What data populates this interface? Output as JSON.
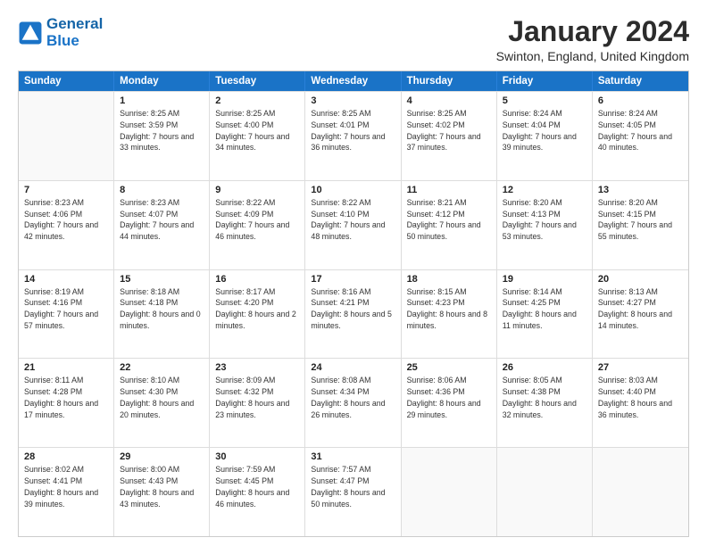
{
  "header": {
    "logo_line1": "General",
    "logo_line2": "Blue",
    "month": "January 2024",
    "location": "Swinton, England, United Kingdom"
  },
  "weekdays": [
    "Sunday",
    "Monday",
    "Tuesday",
    "Wednesday",
    "Thursday",
    "Friday",
    "Saturday"
  ],
  "rows": [
    [
      {
        "day": "",
        "sunrise": "",
        "sunset": "",
        "daylight": ""
      },
      {
        "day": "1",
        "sunrise": "Sunrise: 8:25 AM",
        "sunset": "Sunset: 3:59 PM",
        "daylight": "Daylight: 7 hours and 33 minutes."
      },
      {
        "day": "2",
        "sunrise": "Sunrise: 8:25 AM",
        "sunset": "Sunset: 4:00 PM",
        "daylight": "Daylight: 7 hours and 34 minutes."
      },
      {
        "day": "3",
        "sunrise": "Sunrise: 8:25 AM",
        "sunset": "Sunset: 4:01 PM",
        "daylight": "Daylight: 7 hours and 36 minutes."
      },
      {
        "day": "4",
        "sunrise": "Sunrise: 8:25 AM",
        "sunset": "Sunset: 4:02 PM",
        "daylight": "Daylight: 7 hours and 37 minutes."
      },
      {
        "day": "5",
        "sunrise": "Sunrise: 8:24 AM",
        "sunset": "Sunset: 4:04 PM",
        "daylight": "Daylight: 7 hours and 39 minutes."
      },
      {
        "day": "6",
        "sunrise": "Sunrise: 8:24 AM",
        "sunset": "Sunset: 4:05 PM",
        "daylight": "Daylight: 7 hours and 40 minutes."
      }
    ],
    [
      {
        "day": "7",
        "sunrise": "Sunrise: 8:23 AM",
        "sunset": "Sunset: 4:06 PM",
        "daylight": "Daylight: 7 hours and 42 minutes."
      },
      {
        "day": "8",
        "sunrise": "Sunrise: 8:23 AM",
        "sunset": "Sunset: 4:07 PM",
        "daylight": "Daylight: 7 hours and 44 minutes."
      },
      {
        "day": "9",
        "sunrise": "Sunrise: 8:22 AM",
        "sunset": "Sunset: 4:09 PM",
        "daylight": "Daylight: 7 hours and 46 minutes."
      },
      {
        "day": "10",
        "sunrise": "Sunrise: 8:22 AM",
        "sunset": "Sunset: 4:10 PM",
        "daylight": "Daylight: 7 hours and 48 minutes."
      },
      {
        "day": "11",
        "sunrise": "Sunrise: 8:21 AM",
        "sunset": "Sunset: 4:12 PM",
        "daylight": "Daylight: 7 hours and 50 minutes."
      },
      {
        "day": "12",
        "sunrise": "Sunrise: 8:20 AM",
        "sunset": "Sunset: 4:13 PM",
        "daylight": "Daylight: 7 hours and 53 minutes."
      },
      {
        "day": "13",
        "sunrise": "Sunrise: 8:20 AM",
        "sunset": "Sunset: 4:15 PM",
        "daylight": "Daylight: 7 hours and 55 minutes."
      }
    ],
    [
      {
        "day": "14",
        "sunrise": "Sunrise: 8:19 AM",
        "sunset": "Sunset: 4:16 PM",
        "daylight": "Daylight: 7 hours and 57 minutes."
      },
      {
        "day": "15",
        "sunrise": "Sunrise: 8:18 AM",
        "sunset": "Sunset: 4:18 PM",
        "daylight": "Daylight: 8 hours and 0 minutes."
      },
      {
        "day": "16",
        "sunrise": "Sunrise: 8:17 AM",
        "sunset": "Sunset: 4:20 PM",
        "daylight": "Daylight: 8 hours and 2 minutes."
      },
      {
        "day": "17",
        "sunrise": "Sunrise: 8:16 AM",
        "sunset": "Sunset: 4:21 PM",
        "daylight": "Daylight: 8 hours and 5 minutes."
      },
      {
        "day": "18",
        "sunrise": "Sunrise: 8:15 AM",
        "sunset": "Sunset: 4:23 PM",
        "daylight": "Daylight: 8 hours and 8 minutes."
      },
      {
        "day": "19",
        "sunrise": "Sunrise: 8:14 AM",
        "sunset": "Sunset: 4:25 PM",
        "daylight": "Daylight: 8 hours and 11 minutes."
      },
      {
        "day": "20",
        "sunrise": "Sunrise: 8:13 AM",
        "sunset": "Sunset: 4:27 PM",
        "daylight": "Daylight: 8 hours and 14 minutes."
      }
    ],
    [
      {
        "day": "21",
        "sunrise": "Sunrise: 8:11 AM",
        "sunset": "Sunset: 4:28 PM",
        "daylight": "Daylight: 8 hours and 17 minutes."
      },
      {
        "day": "22",
        "sunrise": "Sunrise: 8:10 AM",
        "sunset": "Sunset: 4:30 PM",
        "daylight": "Daylight: 8 hours and 20 minutes."
      },
      {
        "day": "23",
        "sunrise": "Sunrise: 8:09 AM",
        "sunset": "Sunset: 4:32 PM",
        "daylight": "Daylight: 8 hours and 23 minutes."
      },
      {
        "day": "24",
        "sunrise": "Sunrise: 8:08 AM",
        "sunset": "Sunset: 4:34 PM",
        "daylight": "Daylight: 8 hours and 26 minutes."
      },
      {
        "day": "25",
        "sunrise": "Sunrise: 8:06 AM",
        "sunset": "Sunset: 4:36 PM",
        "daylight": "Daylight: 8 hours and 29 minutes."
      },
      {
        "day": "26",
        "sunrise": "Sunrise: 8:05 AM",
        "sunset": "Sunset: 4:38 PM",
        "daylight": "Daylight: 8 hours and 32 minutes."
      },
      {
        "day": "27",
        "sunrise": "Sunrise: 8:03 AM",
        "sunset": "Sunset: 4:40 PM",
        "daylight": "Daylight: 8 hours and 36 minutes."
      }
    ],
    [
      {
        "day": "28",
        "sunrise": "Sunrise: 8:02 AM",
        "sunset": "Sunset: 4:41 PM",
        "daylight": "Daylight: 8 hours and 39 minutes."
      },
      {
        "day": "29",
        "sunrise": "Sunrise: 8:00 AM",
        "sunset": "Sunset: 4:43 PM",
        "daylight": "Daylight: 8 hours and 43 minutes."
      },
      {
        "day": "30",
        "sunrise": "Sunrise: 7:59 AM",
        "sunset": "Sunset: 4:45 PM",
        "daylight": "Daylight: 8 hours and 46 minutes."
      },
      {
        "day": "31",
        "sunrise": "Sunrise: 7:57 AM",
        "sunset": "Sunset: 4:47 PM",
        "daylight": "Daylight: 8 hours and 50 minutes."
      },
      {
        "day": "",
        "sunrise": "",
        "sunset": "",
        "daylight": ""
      },
      {
        "day": "",
        "sunrise": "",
        "sunset": "",
        "daylight": ""
      },
      {
        "day": "",
        "sunrise": "",
        "sunset": "",
        "daylight": ""
      }
    ]
  ]
}
